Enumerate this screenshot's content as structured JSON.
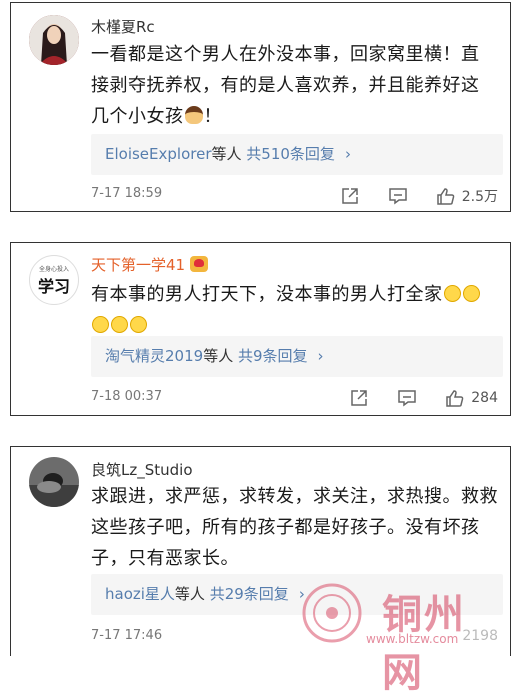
{
  "comments": [
    {
      "username": "木槿夏Rc",
      "text_lines": [
        "一看都是这个男人在外没本事，回家窝里横！直",
        "接剥夺抚养权，有的是人喜欢养，并且能养好这",
        "几个小女孩"
      ],
      "text_suffix": "！",
      "reply_user": "EloiseExplorer",
      "reply_mid": "等人",
      "reply_count": "共510条回复",
      "time": "7-17 18:59",
      "likes": "2.5万"
    },
    {
      "username": "天下第一学41",
      "avatar_text": "学习",
      "avatar_small": "全身心投入",
      "text_lines": [
        "有本事的男人打天下，没本事的男人打全家"
      ],
      "reply_user": "淘气精灵2019",
      "reply_mid": "等人",
      "reply_count": "共9条回复",
      "time": "7-18 00:37",
      "likes": "284"
    },
    {
      "username": "良筑Lz_Studio",
      "text_lines": [
        "求跟进，求严惩，求转发，求关注，求热搜。救救",
        "这些孩子吧，所有的孩子都是好孩子。没有坏孩",
        "子，只有恶家长。"
      ],
      "reply_user": "haozi星人",
      "reply_mid": "等人",
      "reply_count": "共29条回复",
      "time": "7-17 17:46",
      "likes": "2198"
    }
  ],
  "watermark": {
    "name": "铜州网",
    "url": "www.bltzw.com"
  }
}
